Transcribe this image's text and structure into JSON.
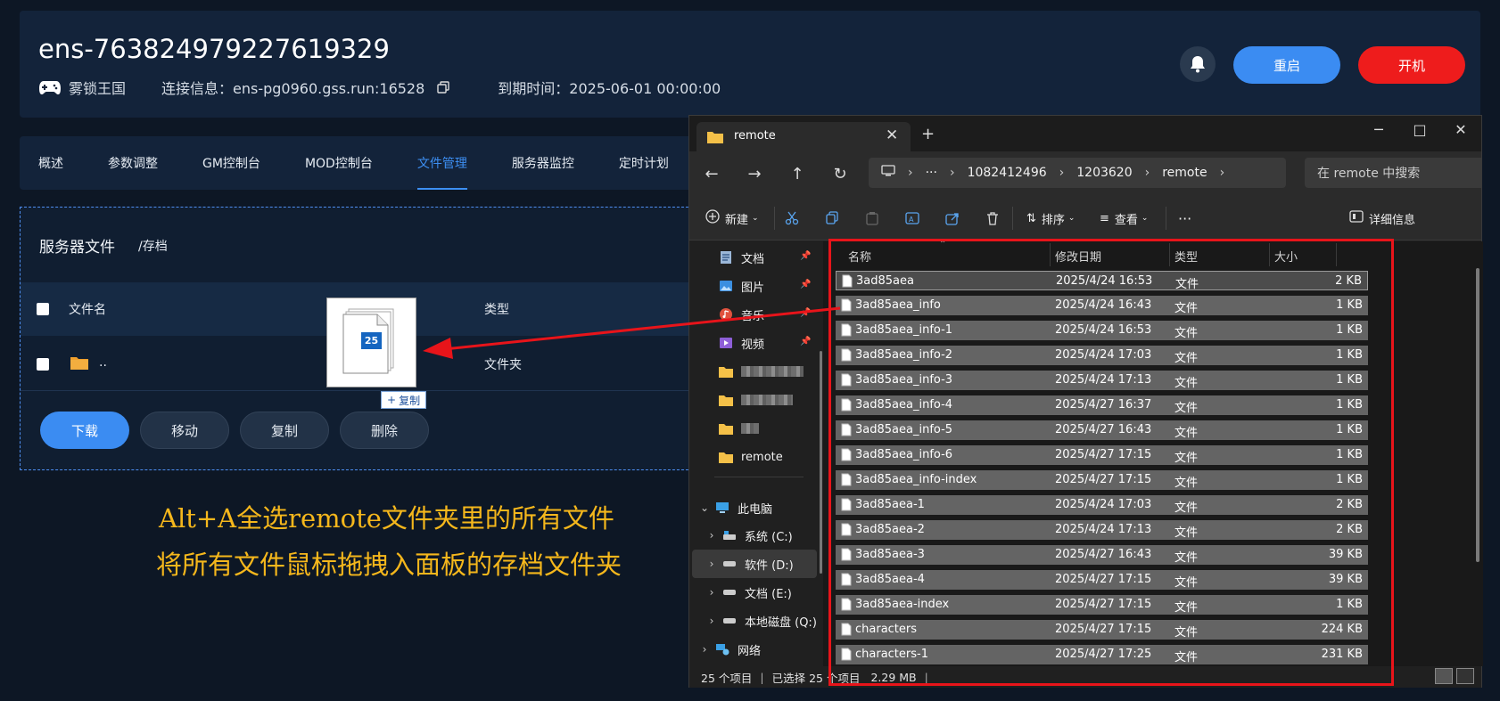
{
  "header": {
    "server_id": "ens-763824979227619329",
    "game": "雾锁王国",
    "connection_label": "连接信息：ens-pg0960.gss.run:16528",
    "expiry_label": "到期时间：2025-06-01 00:00:00",
    "restart_label": "重启",
    "start_label": "开机"
  },
  "tabs": [
    "概述",
    "参数调整",
    "GM控制台",
    "MOD控制台",
    "文件管理",
    "服务器监控",
    "定时计划"
  ],
  "active_tab": "文件管理",
  "file_panel": {
    "title": "服务器文件",
    "path": "/存档",
    "col_name": "文件名",
    "col_type": "类型",
    "parent_name": "..",
    "parent_type": "文件夹",
    "actions": {
      "download": "下载",
      "move": "移动",
      "copy": "复制",
      "delete": "删除"
    }
  },
  "drag": {
    "count": "25",
    "label": "复制"
  },
  "annotation": {
    "line1": "Alt+A全选remote文件夹里的所有文件",
    "line2": "将所有文件鼠标拖拽入面板的存档文件夹"
  },
  "explorer": {
    "tab_title": "remote",
    "address": [
      "1082412496",
      "1203620",
      "remote"
    ],
    "address_more": "···",
    "search_placeholder": "在 remote 中搜索",
    "toolbar": {
      "new": "新建",
      "sort": "排序",
      "view": "查看",
      "more": "···",
      "details": "详细信息"
    },
    "nav_pinned": [
      "文档",
      "图片",
      "音乐",
      "视频"
    ],
    "nav_remote": "remote",
    "nav_this_pc": "此电脑",
    "drives": [
      "系统 (C:)",
      "软件 (D:)",
      "文档 (E:)",
      "本地磁盘 (Q:)"
    ],
    "nav_network": "网络",
    "columns": {
      "name": "名称",
      "date": "修改日期",
      "type": "类型",
      "size": "大小"
    },
    "files": [
      {
        "name": "3ad85aea",
        "date": "2025/4/24 16:53",
        "type": "文件",
        "size": "2 KB"
      },
      {
        "name": "3ad85aea_info",
        "date": "2025/4/24 16:43",
        "type": "文件",
        "size": "1 KB"
      },
      {
        "name": "3ad85aea_info-1",
        "date": "2025/4/24 16:53",
        "type": "文件",
        "size": "1 KB"
      },
      {
        "name": "3ad85aea_info-2",
        "date": "2025/4/24 17:03",
        "type": "文件",
        "size": "1 KB"
      },
      {
        "name": "3ad85aea_info-3",
        "date": "2025/4/24 17:13",
        "type": "文件",
        "size": "1 KB"
      },
      {
        "name": "3ad85aea_info-4",
        "date": "2025/4/27 16:37",
        "type": "文件",
        "size": "1 KB"
      },
      {
        "name": "3ad85aea_info-5",
        "date": "2025/4/27 16:43",
        "type": "文件",
        "size": "1 KB"
      },
      {
        "name": "3ad85aea_info-6",
        "date": "2025/4/27 17:15",
        "type": "文件",
        "size": "1 KB"
      },
      {
        "name": "3ad85aea_info-index",
        "date": "2025/4/27 17:15",
        "type": "文件",
        "size": "1 KB"
      },
      {
        "name": "3ad85aea-1",
        "date": "2025/4/24 17:03",
        "type": "文件",
        "size": "2 KB"
      },
      {
        "name": "3ad85aea-2",
        "date": "2025/4/24 17:13",
        "type": "文件",
        "size": "2 KB"
      },
      {
        "name": "3ad85aea-3",
        "date": "2025/4/27 16:43",
        "type": "文件",
        "size": "39 KB"
      },
      {
        "name": "3ad85aea-4",
        "date": "2025/4/27 17:15",
        "type": "文件",
        "size": "39 KB"
      },
      {
        "name": "3ad85aea-index",
        "date": "2025/4/27 17:15",
        "type": "文件",
        "size": "1 KB"
      },
      {
        "name": "characters",
        "date": "2025/4/27 17:15",
        "type": "文件",
        "size": "224 KB"
      },
      {
        "name": "characters-1",
        "date": "2025/4/27 17:25",
        "type": "文件",
        "size": "231 KB"
      }
    ],
    "status": {
      "count": "25 个项目",
      "selected": "已选择 25 个项目",
      "size": "2.29 MB"
    }
  },
  "colors": {
    "accent": "#3b8cf2",
    "danger": "#ee1c1c",
    "annotation": "#f5b71c",
    "highlight": "#e8141a"
  }
}
